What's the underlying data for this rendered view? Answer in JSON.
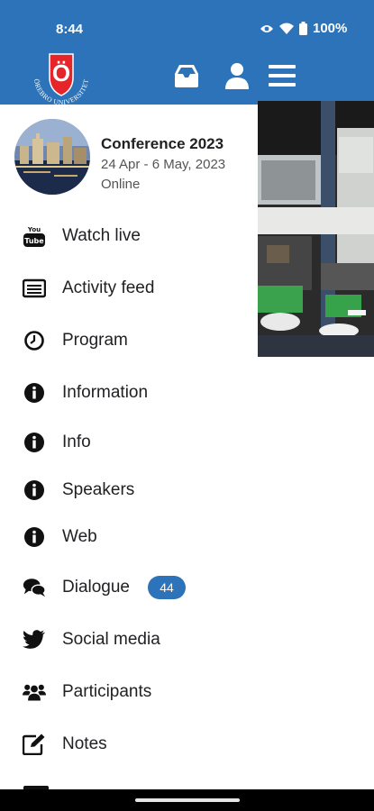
{
  "status_bar": {
    "time": "8:44",
    "battery": "100%"
  },
  "header": {
    "logo": {
      "letter": "Ö",
      "ring_text": "ÖREBRO UNIVERSITET"
    },
    "icons": [
      "inbox-icon",
      "user-icon",
      "menu-icon"
    ]
  },
  "conference": {
    "title": "Conference 2023",
    "dates": "24 Apr - 6 May, 2023",
    "mode": "Online"
  },
  "menu": [
    {
      "label": "Watch live",
      "icon": "youtube-icon"
    },
    {
      "label": "Activity feed",
      "icon": "feed-icon"
    },
    {
      "label": "Program",
      "icon": "clock-icon"
    },
    {
      "label": "Information",
      "icon": "info-icon"
    },
    {
      "label": "Info",
      "icon": "info-icon"
    },
    {
      "label": "Speakers",
      "icon": "info-icon"
    },
    {
      "label": "Web",
      "icon": "info-icon"
    },
    {
      "label": "Dialogue",
      "icon": "chat-icon",
      "badge": "44"
    },
    {
      "label": "Social media",
      "icon": "twitter-icon"
    },
    {
      "label": "Participants",
      "icon": "users-icon"
    },
    {
      "label": "Notes",
      "icon": "edit-icon"
    }
  ],
  "colors": {
    "brand": "#2c73b9",
    "text": "#202124"
  }
}
